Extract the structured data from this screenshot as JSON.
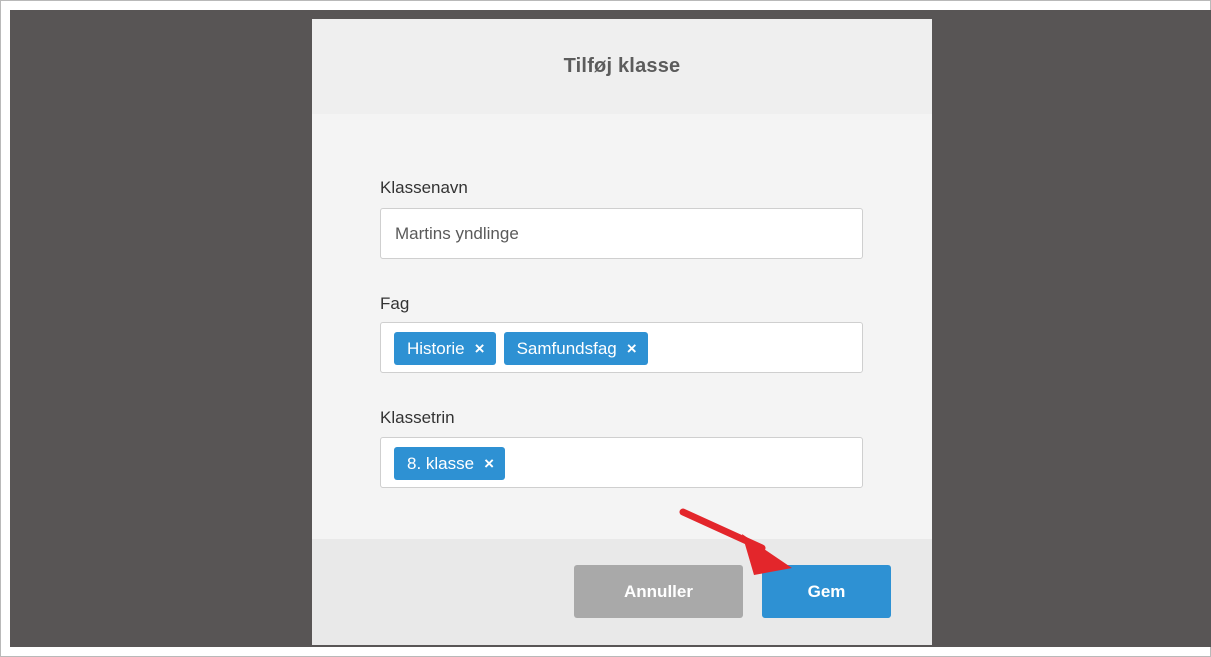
{
  "modal": {
    "title": "Tilføj klasse"
  },
  "fields": {
    "class_name": {
      "label": "Klassenavn",
      "value": "Martins yndlinge"
    },
    "subjects": {
      "label": "Fag",
      "tags": [
        "Historie",
        "Samfundsfag"
      ]
    },
    "grade": {
      "label": "Klassetrin",
      "tags": [
        "8. klasse"
      ]
    }
  },
  "footer": {
    "cancel_label": "Annuller",
    "save_label": "Gem"
  },
  "icons": {
    "tag_remove": "×"
  },
  "colors": {
    "overlay": "#585555",
    "accent": "#2e91d3",
    "cancel": "#a9a9a9",
    "annotation_arrow": "#e3262b"
  }
}
